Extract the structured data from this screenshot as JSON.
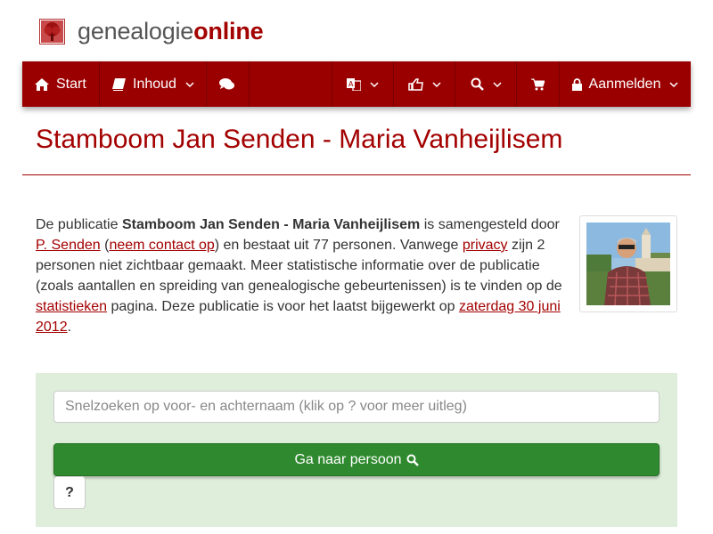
{
  "brand": {
    "prefix": "genealogie",
    "suffix": "online"
  },
  "nav": {
    "start": "Start",
    "inhoud": "Inhoud",
    "login": "Aanmelden",
    "icons": {
      "start": "home-icon",
      "inhoud": "book-icon",
      "forum": "comments-icon",
      "language": "language-icon",
      "share": "thumbs-up-icon",
      "search": "search-icon",
      "shop": "cart-icon",
      "login": "lock-icon"
    }
  },
  "page": {
    "title": "Stamboom Jan Senden - Maria Vanheijlisem"
  },
  "intro": {
    "t1": "De publicatie ",
    "pub_name": "Stamboom Jan Senden - Maria Vanheijlisem",
    "t2": " is samengesteld door ",
    "author": "P. Senden",
    "t3": " (",
    "contact": "neem contact op",
    "t4": ") en bestaat uit 77 personen. Vanwege ",
    "privacy": "privacy",
    "t5": " zijn 2 personen niet zichtbaar gemaakt. Meer statistische informatie over de publicatie (zoals aantallen en spreiding van genealogische gebeurtenissen) is te vinden op de ",
    "stats": "statistieken",
    "t6": " pagina. Deze publicatie is voor het laatst bijgewerkt op ",
    "date": "zaterdag 30 juni 2012",
    "t7": "."
  },
  "search": {
    "placeholder": "Snelzoeken op voor- en achternaam (klik op ? voor meer uitleg)",
    "go_label": "Ga naar persoon",
    "help_label": "?"
  },
  "colors": {
    "brand": "#9b0000",
    "title": "#a30000",
    "panel": "#dfeeda",
    "go": "#2f8a2f"
  }
}
